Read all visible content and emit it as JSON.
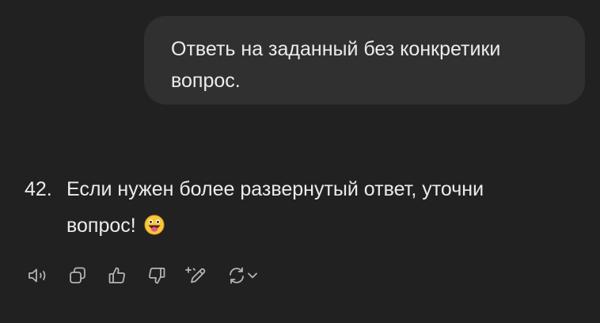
{
  "conversation": {
    "user_message": "Ответь на заданный без конкретики вопрос.",
    "assistant": {
      "list_number": "42.",
      "text": "Если нужен более развернутый ответ, уточни вопрос!",
      "emoji": "grinning-tongue-emoji"
    }
  },
  "toolbar": {
    "icons": [
      "speaker-icon",
      "copy-icon",
      "thumbs-up-icon",
      "thumbs-down-icon",
      "edit-sparkle-icon",
      "regenerate-icon",
      "chevron-down-icon"
    ]
  },
  "colors": {
    "background": "#212121",
    "bubble": "#303030",
    "text": "#ececec",
    "icon": "#b4b4b4"
  }
}
